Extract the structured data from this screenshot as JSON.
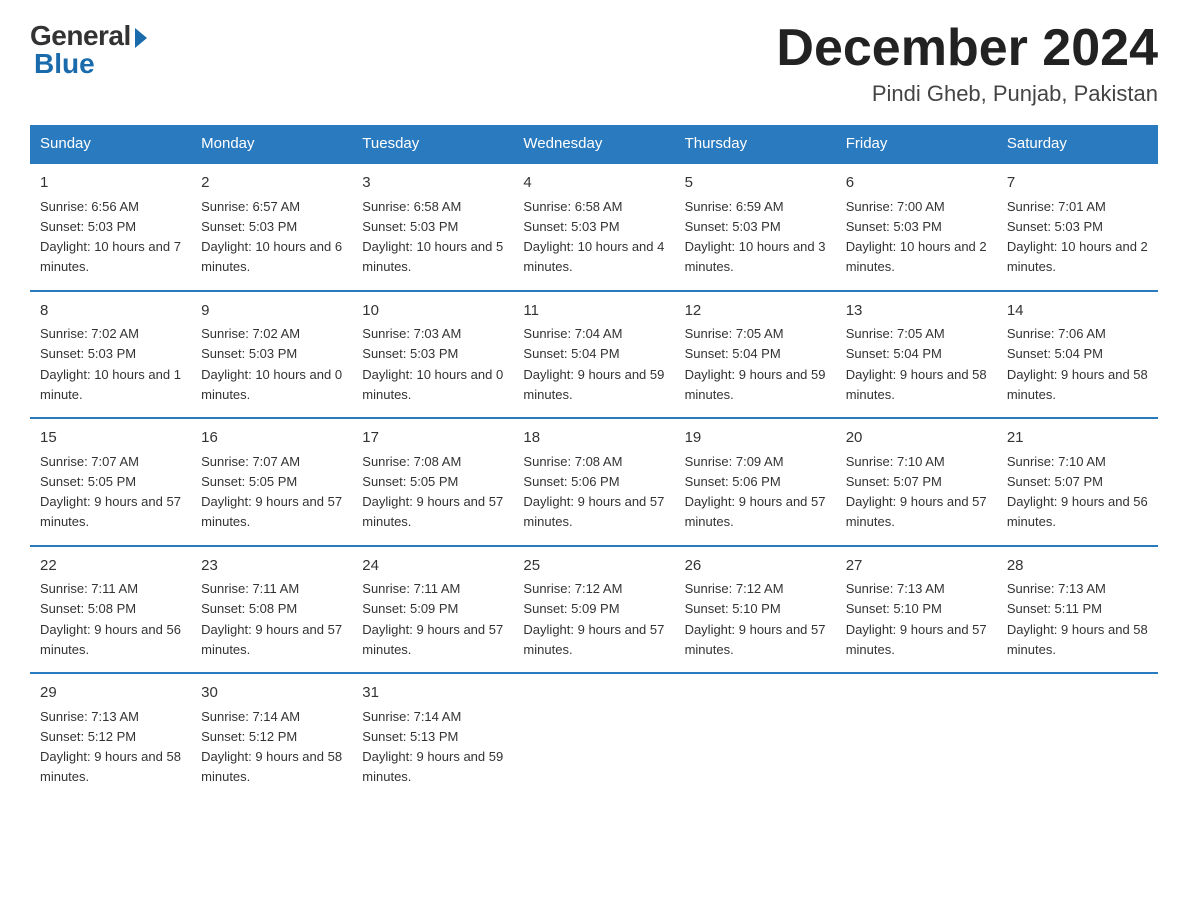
{
  "header": {
    "logo_general": "General",
    "logo_blue": "Blue",
    "month_title": "December 2024",
    "location": "Pindi Gheb, Punjab, Pakistan"
  },
  "days_of_week": [
    "Sunday",
    "Monday",
    "Tuesday",
    "Wednesday",
    "Thursday",
    "Friday",
    "Saturday"
  ],
  "weeks": [
    [
      {
        "num": "1",
        "sunrise": "6:56 AM",
        "sunset": "5:03 PM",
        "daylight": "10 hours and 7 minutes."
      },
      {
        "num": "2",
        "sunrise": "6:57 AM",
        "sunset": "5:03 PM",
        "daylight": "10 hours and 6 minutes."
      },
      {
        "num": "3",
        "sunrise": "6:58 AM",
        "sunset": "5:03 PM",
        "daylight": "10 hours and 5 minutes."
      },
      {
        "num": "4",
        "sunrise": "6:58 AM",
        "sunset": "5:03 PM",
        "daylight": "10 hours and 4 minutes."
      },
      {
        "num": "5",
        "sunrise": "6:59 AM",
        "sunset": "5:03 PM",
        "daylight": "10 hours and 3 minutes."
      },
      {
        "num": "6",
        "sunrise": "7:00 AM",
        "sunset": "5:03 PM",
        "daylight": "10 hours and 2 minutes."
      },
      {
        "num": "7",
        "sunrise": "7:01 AM",
        "sunset": "5:03 PM",
        "daylight": "10 hours and 2 minutes."
      }
    ],
    [
      {
        "num": "8",
        "sunrise": "7:02 AM",
        "sunset": "5:03 PM",
        "daylight": "10 hours and 1 minute."
      },
      {
        "num": "9",
        "sunrise": "7:02 AM",
        "sunset": "5:03 PM",
        "daylight": "10 hours and 0 minutes."
      },
      {
        "num": "10",
        "sunrise": "7:03 AM",
        "sunset": "5:03 PM",
        "daylight": "10 hours and 0 minutes."
      },
      {
        "num": "11",
        "sunrise": "7:04 AM",
        "sunset": "5:04 PM",
        "daylight": "9 hours and 59 minutes."
      },
      {
        "num": "12",
        "sunrise": "7:05 AM",
        "sunset": "5:04 PM",
        "daylight": "9 hours and 59 minutes."
      },
      {
        "num": "13",
        "sunrise": "7:05 AM",
        "sunset": "5:04 PM",
        "daylight": "9 hours and 58 minutes."
      },
      {
        "num": "14",
        "sunrise": "7:06 AM",
        "sunset": "5:04 PM",
        "daylight": "9 hours and 58 minutes."
      }
    ],
    [
      {
        "num": "15",
        "sunrise": "7:07 AM",
        "sunset": "5:05 PM",
        "daylight": "9 hours and 57 minutes."
      },
      {
        "num": "16",
        "sunrise": "7:07 AM",
        "sunset": "5:05 PM",
        "daylight": "9 hours and 57 minutes."
      },
      {
        "num": "17",
        "sunrise": "7:08 AM",
        "sunset": "5:05 PM",
        "daylight": "9 hours and 57 minutes."
      },
      {
        "num": "18",
        "sunrise": "7:08 AM",
        "sunset": "5:06 PM",
        "daylight": "9 hours and 57 minutes."
      },
      {
        "num": "19",
        "sunrise": "7:09 AM",
        "sunset": "5:06 PM",
        "daylight": "9 hours and 57 minutes."
      },
      {
        "num": "20",
        "sunrise": "7:10 AM",
        "sunset": "5:07 PM",
        "daylight": "9 hours and 57 minutes."
      },
      {
        "num": "21",
        "sunrise": "7:10 AM",
        "sunset": "5:07 PM",
        "daylight": "9 hours and 56 minutes."
      }
    ],
    [
      {
        "num": "22",
        "sunrise": "7:11 AM",
        "sunset": "5:08 PM",
        "daylight": "9 hours and 56 minutes."
      },
      {
        "num": "23",
        "sunrise": "7:11 AM",
        "sunset": "5:08 PM",
        "daylight": "9 hours and 57 minutes."
      },
      {
        "num": "24",
        "sunrise": "7:11 AM",
        "sunset": "5:09 PM",
        "daylight": "9 hours and 57 minutes."
      },
      {
        "num": "25",
        "sunrise": "7:12 AM",
        "sunset": "5:09 PM",
        "daylight": "9 hours and 57 minutes."
      },
      {
        "num": "26",
        "sunrise": "7:12 AM",
        "sunset": "5:10 PM",
        "daylight": "9 hours and 57 minutes."
      },
      {
        "num": "27",
        "sunrise": "7:13 AM",
        "sunset": "5:10 PM",
        "daylight": "9 hours and 57 minutes."
      },
      {
        "num": "28",
        "sunrise": "7:13 AM",
        "sunset": "5:11 PM",
        "daylight": "9 hours and 58 minutes."
      }
    ],
    [
      {
        "num": "29",
        "sunrise": "7:13 AM",
        "sunset": "5:12 PM",
        "daylight": "9 hours and 58 minutes."
      },
      {
        "num": "30",
        "sunrise": "7:14 AM",
        "sunset": "5:12 PM",
        "daylight": "9 hours and 58 minutes."
      },
      {
        "num": "31",
        "sunrise": "7:14 AM",
        "sunset": "5:13 PM",
        "daylight": "9 hours and 59 minutes."
      },
      {
        "num": "",
        "sunrise": "",
        "sunset": "",
        "daylight": ""
      },
      {
        "num": "",
        "sunrise": "",
        "sunset": "",
        "daylight": ""
      },
      {
        "num": "",
        "sunrise": "",
        "sunset": "",
        "daylight": ""
      },
      {
        "num": "",
        "sunrise": "",
        "sunset": "",
        "daylight": ""
      }
    ]
  ]
}
